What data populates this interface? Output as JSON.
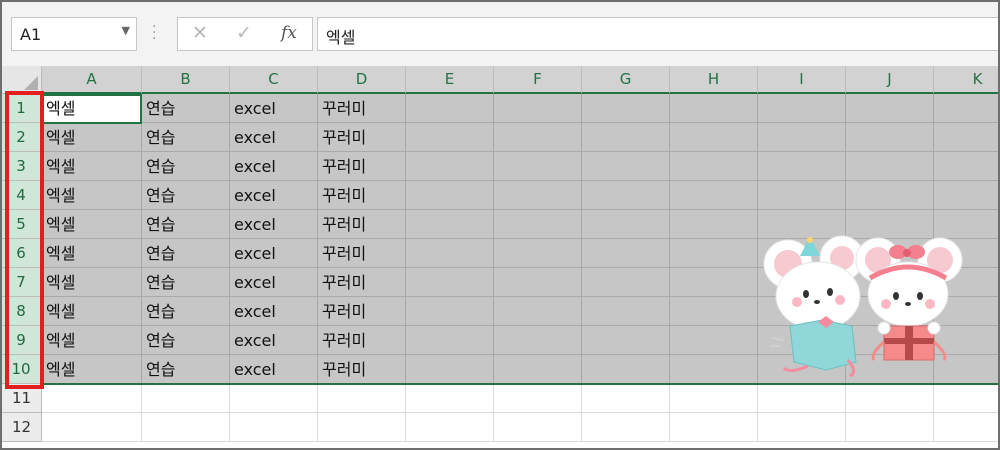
{
  "formula_bar": {
    "name_box": "A1",
    "cancel_icon": "✕",
    "enter_icon": "✓",
    "fx_label": "fx",
    "content": "엑셀"
  },
  "columns": [
    "A",
    "B",
    "C",
    "D",
    "E",
    "F",
    "G",
    "H",
    "I",
    "J",
    "K"
  ],
  "rows": [
    {
      "num": "1",
      "a": "엑셀",
      "b": "연습",
      "c": "excel",
      "d": "꾸러미"
    },
    {
      "num": "2",
      "a": "엑셀",
      "b": "연습",
      "c": "excel",
      "d": "꾸러미"
    },
    {
      "num": "3",
      "a": "엑셀",
      "b": "연습",
      "c": "excel",
      "d": "꾸러미"
    },
    {
      "num": "4",
      "a": "엑셀",
      "b": "연습",
      "c": "excel",
      "d": "꾸러미"
    },
    {
      "num": "5",
      "a": "엑셀",
      "b": "연습",
      "c": "excel",
      "d": "꾸러미"
    },
    {
      "num": "6",
      "a": "엑셀",
      "b": "연습",
      "c": "excel",
      "d": "꾸러미"
    },
    {
      "num": "7",
      "a": "엑셀",
      "b": "연습",
      "c": "excel",
      "d": "꾸러미"
    },
    {
      "num": "8",
      "a": "엑셀",
      "b": "연습",
      "c": "excel",
      "d": "꾸러미"
    },
    {
      "num": "9",
      "a": "엑셀",
      "b": "연습",
      "c": "excel",
      "d": "꾸러미"
    },
    {
      "num": "10",
      "a": "엑셀",
      "b": "연습",
      "c": "excel",
      "d": "꾸러미"
    },
    {
      "num": "11",
      "a": "",
      "b": "",
      "c": "",
      "d": ""
    },
    {
      "num": "12",
      "a": "",
      "b": "",
      "c": "",
      "d": ""
    }
  ],
  "selected_row_count": 10,
  "colors": {
    "excel_green": "#217346",
    "highlight_red": "#e21e1e",
    "selection_gray": "#c6c6c6"
  },
  "decoration": {
    "icon": "mice-with-gift-sticker"
  }
}
